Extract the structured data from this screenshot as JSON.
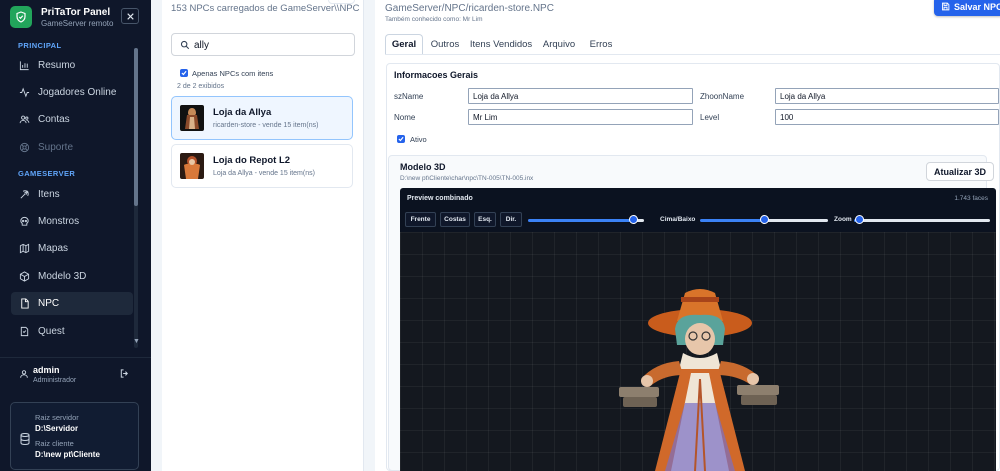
{
  "brand": {
    "title": "PriTaTor Panel",
    "subtitle": "GameServer remoto"
  },
  "sidebar": {
    "section_principal": "PRINCIPAL",
    "section_gameserver": "GAMESERVER",
    "items": [
      {
        "label": "Resumo",
        "icon": "chart-icon"
      },
      {
        "label": "Jogadores Online",
        "icon": "activity-icon"
      },
      {
        "label": "Contas",
        "icon": "users-icon"
      },
      {
        "label": "Suporte",
        "icon": "lifebuoy-icon"
      },
      {
        "label": "Itens",
        "icon": "pickaxe-icon"
      },
      {
        "label": "Monstros",
        "icon": "skull-icon"
      },
      {
        "label": "Mapas",
        "icon": "map-icon"
      },
      {
        "label": "Modelo 3D",
        "icon": "cube-icon"
      },
      {
        "label": "NPC",
        "icon": "document-icon"
      },
      {
        "label": "Quest",
        "icon": "quest-icon"
      }
    ],
    "active_item": "NPC",
    "user": {
      "name": "admin",
      "role": "Administrador"
    },
    "server": {
      "raiz_servidor_label": "Raiz servidor",
      "raiz_servidor_value": "D:\\Servidor",
      "raiz_cliente_label": "Raiz cliente",
      "raiz_cliente_value": "D:\\new pt\\Cliente"
    }
  },
  "npc_list": {
    "count_text": "153 NPCs carregados de GameServer\\\\NPC",
    "search_value": "ally",
    "search_placeholder": "Buscar NPC",
    "filter_label": "Apenas NPCs com itens",
    "filter_checked": true,
    "results_count": "2 de 2 exibidos",
    "items": [
      {
        "name": "Loja da Allya",
        "subtitle": "ricarden-store - vende 15 item(ns)",
        "selected": true
      },
      {
        "name": "Loja do Repot L2",
        "subtitle": "Loja da Allya - vende 15 item(ns)",
        "selected": false
      }
    ]
  },
  "editor": {
    "file_path": "GameServer/NPC/ricarden-store.NPC",
    "aka": "Também conhecido como: Mr Lim",
    "save_label": "Salvar NPC",
    "tabs": [
      "Geral",
      "Outros",
      "Itens Vendidos",
      "Arquivo",
      "Erros"
    ],
    "active_tab": "Geral",
    "general": {
      "title": "Informacoes Gerais",
      "szname_label": "szName",
      "szname_value": "Loja da Allya",
      "zhoonname_label": "ZhoonName",
      "zhoonname_value": "Loja da Allya",
      "nome_label": "Nome",
      "nome_value": "Mr Lim",
      "level_label": "Level",
      "level_value": "100",
      "ativo_label": "Ativo",
      "ativo_checked": true
    },
    "model": {
      "title": "Modelo 3D",
      "path": "D:\\new pt\\Cliente\\char\\npc\\TN-005\\TN-005.inx",
      "refresh_label": "Atualizar 3D",
      "preview_title": "Preview combinado",
      "faces": "1.743 faces",
      "view_buttons": [
        "Frente",
        "Costas",
        "Esq.",
        "Dir."
      ],
      "slider_up_down_label": "Cima/Baixo",
      "slider_zoom_label": "Zoom",
      "slider_rotation_value": 0.94,
      "slider_updown_value": 0.5,
      "slider_zoom_value": 0.01
    }
  },
  "colors": {
    "sidebar_bg": "#0f172a",
    "accent": "#2563eb",
    "brand_green": "#22a55b",
    "section_label": "#60a5fa"
  }
}
